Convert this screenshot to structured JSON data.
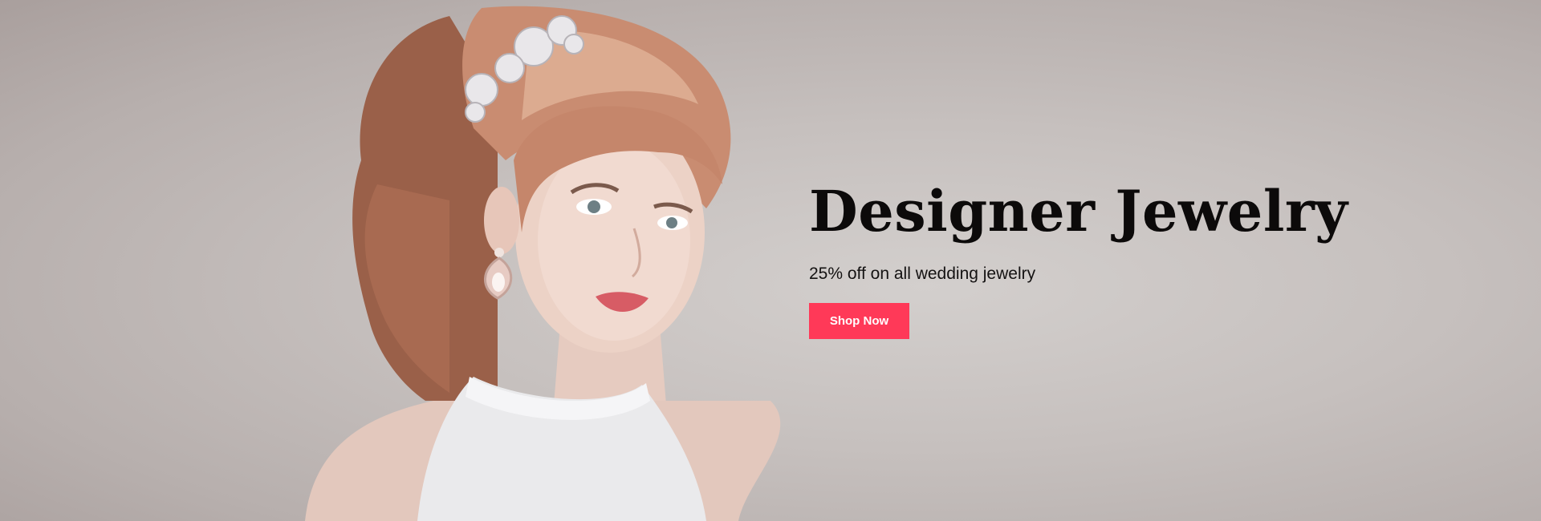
{
  "hero": {
    "title": "Designer Jewelry",
    "subtitle": "25% off on all wedding jewelry",
    "cta_label": "Shop Now",
    "accent_color": "#ff3958",
    "background_color": "#c6c0be",
    "image_subject": "woman-with-jewelry-portrait"
  }
}
